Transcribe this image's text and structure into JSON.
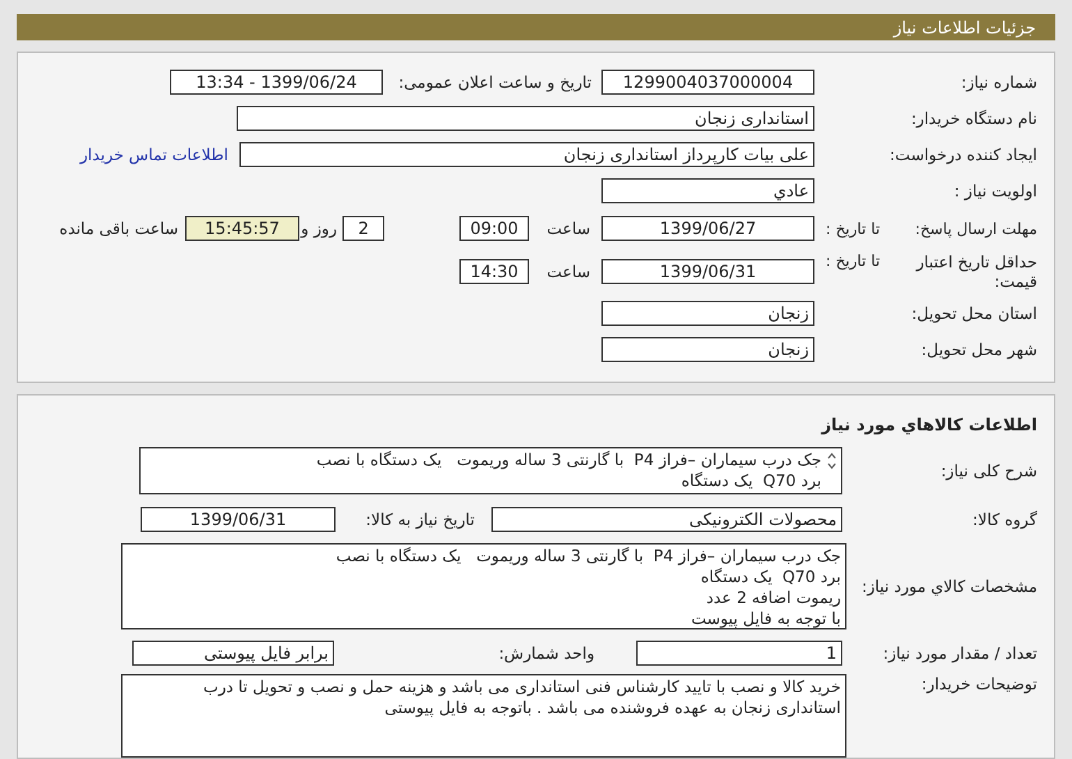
{
  "header": {
    "title": "جزئیات اطلاعات نیاز"
  },
  "general": {
    "need_number": {
      "label": "شماره نیاز:",
      "value": "1299004037000004"
    },
    "announce": {
      "label": "تاریخ و ساعت اعلان عمومی:",
      "value": "1399/06/24 - 13:34"
    },
    "buyer": {
      "label": "نام دستگاه خریدار:",
      "value": "استانداری زنجان"
    },
    "creator": {
      "label": "ایجاد کننده درخواست:",
      "value": "علی بیات کارپرداز  استانداری زنجان",
      "link": "اطلاعات تماس خریدار"
    },
    "priority": {
      "label": "اولویت نیاز :",
      "value": "عادي"
    },
    "deadline": {
      "label": "مهلت ارسال پاسخ:",
      "to_label": "تا تاریخ :",
      "date": "1399/06/27",
      "time_label": "ساعت",
      "time": "09:00",
      "days": "2",
      "days_label": "روز و",
      "remaining": "15:45:57",
      "remaining_label": "ساعت باقی مانده"
    },
    "validity": {
      "label": "حداقل تاریخ اعتبار قیمت:",
      "to_label": "تا تاریخ :",
      "date": "1399/06/31",
      "time_label": "ساعت",
      "time": "14:30"
    },
    "province": {
      "label": "استان محل تحویل:",
      "value": "زنجان"
    },
    "city": {
      "label": "شهر محل تحویل:",
      "value": "زنجان"
    }
  },
  "goods": {
    "title": "اطلاعات کالاهاي مورد نياز",
    "summary": {
      "label": "شرح کلی نیاز:",
      "lines": [
        "جک درب سیماران –فراز P4  با گارنتی 3 ساله وریموت   یک دستگاه با نصب",
        "برد Q70  یک دستگاه"
      ]
    },
    "group": {
      "label": "گروه کالا:",
      "value": "محصولات الکترونیکی",
      "date_label": "تاریخ نیاز به کالا:",
      "date": "1399/06/31"
    },
    "specs": {
      "label": "مشخصات کالاي مورد نياز:",
      "lines": [
        "جک درب سیماران –فراز P4  با گارنتی 3 ساله وریموت   یک دستگاه با نصب",
        "برد Q70  یک دستگاه",
        "ریموت اضافه 2 عدد",
        "با توجه به فایل پیوست"
      ]
    },
    "quantity": {
      "label": "تعداد / مقدار مورد نیاز:",
      "value": "1",
      "unit_label": "واحد شمارش:",
      "unit": "برابر فایل پیوستی"
    },
    "buyer_notes": {
      "label": "توضیحات خریدار:",
      "lines": [
        "خرید کالا و نصب با تایید کارشناس فنی استانداری می باشد و هزینه حمل و نصب و تحویل تا درب",
        "استانداری زنجان به عهده فروشنده می باشد . باتوجه به فایل پیوستی"
      ]
    }
  }
}
